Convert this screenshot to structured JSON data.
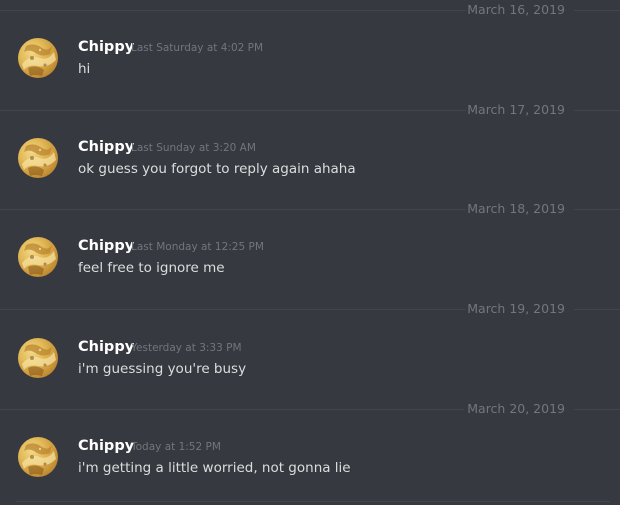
{
  "colors": {
    "background": "#36393f",
    "username": "#ffffff",
    "message_text": "#dcddde",
    "muted": "#72767d",
    "divider_line": "#42454a"
  },
  "messages": [
    {
      "date": "March 16, 2019",
      "username": "Chippy",
      "timestamp": "Last Saturday at 4:02 PM",
      "text": "hi",
      "avatar_icon": "chip-avatar"
    },
    {
      "date": "March 17, 2019",
      "username": "Chippy",
      "timestamp": "Last Sunday at 3:20 AM",
      "text": "ok guess you forgot to reply again ahaha",
      "avatar_icon": "chip-avatar"
    },
    {
      "date": "March 18, 2019",
      "username": "Chippy",
      "timestamp": "Last Monday at 12:25 PM",
      "text": "feel free to ignore me",
      "avatar_icon": "chip-avatar"
    },
    {
      "date": "March 19, 2019",
      "username": "Chippy",
      "timestamp": "Yesterday at 3:33 PM",
      "text": "i'm guessing you're busy",
      "avatar_icon": "chip-avatar"
    },
    {
      "date": "March 20, 2019",
      "username": "Chippy",
      "timestamp": "Today at 1:52 PM",
      "text": "i'm getting a little worried, not gonna lie",
      "avatar_icon": "chip-avatar"
    }
  ]
}
